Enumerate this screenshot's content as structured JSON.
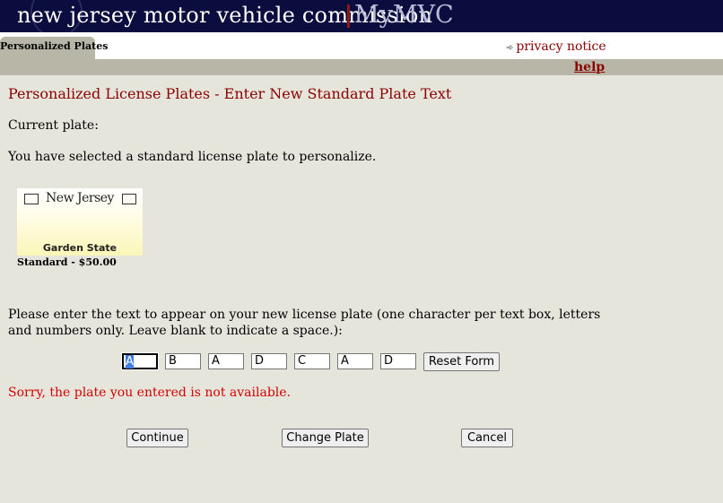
{
  "header": {
    "title": "new jersey motor vehicle commission",
    "brand": "MyMVC"
  },
  "tabs": [
    {
      "label": "Personalized Plates"
    }
  ],
  "links": {
    "privacy": "privacy notice",
    "help": "help"
  },
  "page": {
    "heading_main": "Personalized License Plates",
    "heading_sep": " - ",
    "heading_sub": "Enter New Standard Plate Text",
    "current_plate_label": "Current plate:",
    "current_plate_value": "",
    "selected_text": "You have selected a standard license plate to personalize.",
    "instructions": "Please enter the text to appear on your new license plate (one character per text box, letters and numbers only. Leave blank to indicate a space.):",
    "error": "Sorry, the plate you entered is not available."
  },
  "plate": {
    "state": "New Jersey",
    "slogan": "Garden State",
    "caption": "Standard - $50.00"
  },
  "plate_chars": [
    "A",
    "B",
    "A",
    "D",
    "C",
    "A",
    "D"
  ],
  "buttons": {
    "reset": "Reset Form",
    "continue": "Continue",
    "change_plate": "Change Plate",
    "cancel": "Cancel"
  },
  "colors": {
    "banner": "#0b0d3e",
    "accent": "#8b0000",
    "error": "#d40000",
    "page_bg": "#e6e5dc",
    "bar": "#b8b7a7"
  }
}
